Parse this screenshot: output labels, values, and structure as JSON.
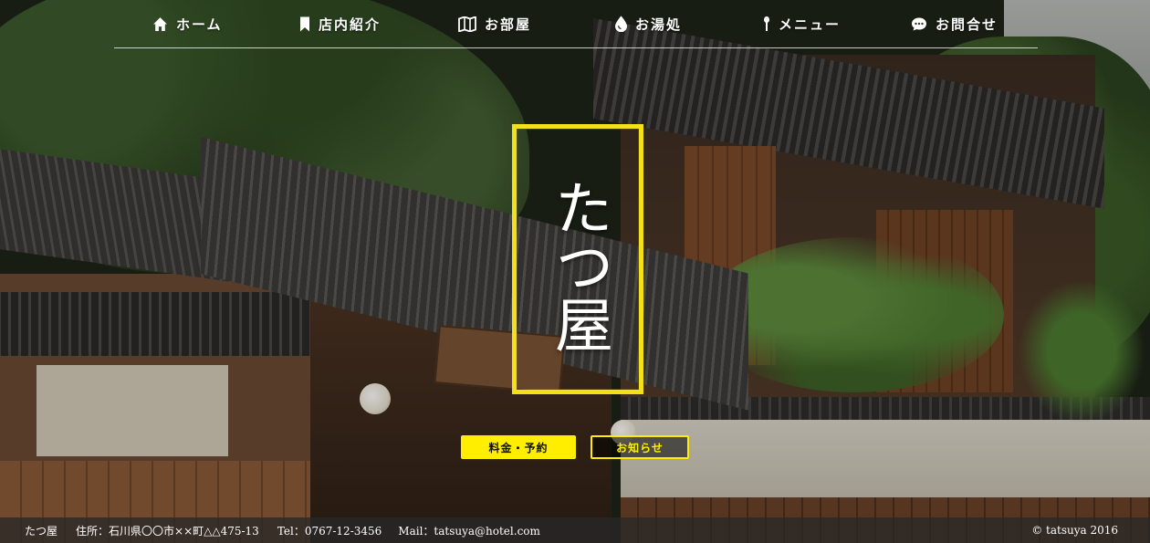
{
  "nav": {
    "items": [
      {
        "label": "ホーム",
        "icon": "home-icon"
      },
      {
        "label": "店内紹介",
        "icon": "bookmark-icon"
      },
      {
        "label": "お部屋",
        "icon": "map-icon"
      },
      {
        "label": "お湯処",
        "icon": "water-drop-icon"
      },
      {
        "label": "メニュー",
        "icon": "utensil-icon"
      },
      {
        "label": "お問合せ",
        "icon": "chat-bubble-icon"
      }
    ]
  },
  "logo": {
    "text": "たつ屋",
    "border_color": "#f3e018"
  },
  "buttons": {
    "reserve_label": "料金・予約",
    "news_label": "お知らせ",
    "accent_color": "#ffee00"
  },
  "footer": {
    "name": "たつ屋",
    "address": "住所：石川県〇〇市××町△△475-13",
    "tel": "Tel：0767-12-3456",
    "mail": "Mail：tatsuya@hotel.com",
    "copyright": "© tatsuya 2016"
  }
}
